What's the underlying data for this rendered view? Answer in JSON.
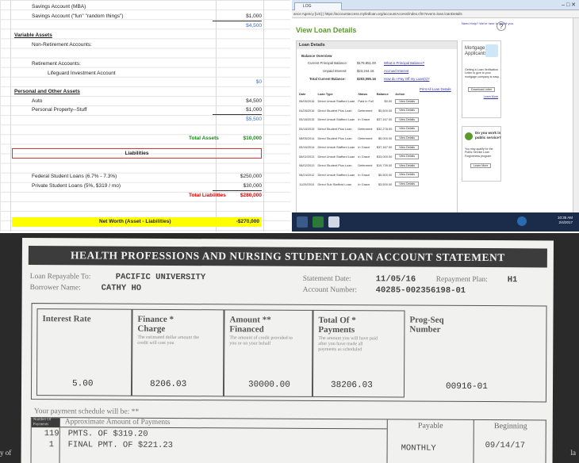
{
  "spreadsheet": {
    "rows": [
      {
        "label": "Savings Account (MBA)",
        "indent": 1,
        "value": "",
        "style": ""
      },
      {
        "label": "Savings Account (\"fun\" \"random things\")",
        "indent": 1,
        "value": "$1,000",
        "style": "ul"
      },
      {
        "label": "",
        "indent": 0,
        "value": "$4,500",
        "style": "blue"
      },
      {
        "label": "Variable Assets",
        "indent": 0,
        "value": "",
        "style": "sec"
      },
      {
        "label": "Non-Retirement Accounts:",
        "indent": 1,
        "value": "",
        "style": ""
      },
      {
        "label": "",
        "indent": 0,
        "value": "",
        "style": ""
      },
      {
        "label": "Retirement Accounts:",
        "indent": 1,
        "value": "",
        "style": ""
      },
      {
        "label": "Lifeguard Investment Account",
        "indent": 2,
        "value": "",
        "style": ""
      },
      {
        "label": "",
        "indent": 0,
        "value": "$0",
        "style": "blue"
      },
      {
        "label": "Personal and Other Assets",
        "indent": 0,
        "value": "",
        "style": "sec"
      },
      {
        "label": "Auto",
        "indent": 1,
        "value": "$4,500",
        "style": ""
      },
      {
        "label": "Personal Property--Stuff",
        "indent": 1,
        "value": "$1,000",
        "style": "ul"
      },
      {
        "label": "",
        "indent": 0,
        "value": "$5,500",
        "style": "blue"
      },
      {
        "label": "",
        "indent": 0,
        "value": "",
        "style": ""
      },
      {
        "label": "Total Assets",
        "indent": 3,
        "value": "$10,000",
        "style": "green"
      },
      {
        "label": "",
        "indent": 0,
        "value": "",
        "style": ""
      },
      {
        "label": "",
        "indent": 0,
        "value": "",
        "style": ""
      },
      {
        "label": "Federal Student Loans (6.7% - 7.3%)",
        "indent": 1,
        "value": "$250,000",
        "style": ""
      },
      {
        "label": "Private Student Loans (5%, $319 / mo)",
        "indent": 1,
        "value": "$30,000",
        "style": "ul"
      },
      {
        "label": "Total Liabilities",
        "indent": 3,
        "value": "$280,000",
        "style": "red"
      }
    ],
    "liabilities_label": "Liabilities",
    "net_worth_label": "Net Worth (Asset - Liabilities)",
    "net_worth_value": "-$270,000"
  },
  "browser": {
    "tab_label": "LOG",
    "address": "ance Agency [US] | https://accountaccess.myfedloan.org/accountAccess/index.cfm?event=loan.loanDetails",
    "page_title": "View Loan Details",
    "help_text": "Need Help? We're here to assist you.",
    "panel_title": "Loan Details",
    "balance_overview": "Balance Overview",
    "balances": [
      {
        "label": "Current Principal Balance:",
        "value": "$179,851.00",
        "link": "What is Principal Balance?"
      },
      {
        "label": "Unpaid Interest:",
        "value": "$23,244.16",
        "link": "Accrued Interest"
      },
      {
        "label": "Total Current Balance:",
        "value": "$203,095.16",
        "link": "How do I Pay Off my Loan(s)?"
      }
    ],
    "print_link": "Print All Loan Details",
    "table_headers": [
      "Date",
      "Loan Type",
      "Status",
      "Balance",
      "Action"
    ],
    "loans": [
      {
        "date": "06/05/2016",
        "type": "Direct Unsub Stafford Loan",
        "status": "Paid In Full",
        "balance": "$0.00"
      },
      {
        "date": "04/28/2016",
        "type": "Direct Student Plus Loan",
        "status": "Deferment",
        "balance": "$5,500.00"
      },
      {
        "date": "05/18/2015",
        "type": "Direct Unsub Stafford Loan",
        "status": "In Grace",
        "balance": "$37,167.00"
      },
      {
        "date": "05/18/2015",
        "type": "Direct Student Plus Loan",
        "status": "Deferment",
        "balance": "$32,278.00"
      },
      {
        "date": "08/05/2014",
        "type": "Direct Student Plus Loan",
        "status": "Deferment",
        "balance": "$5,000.00"
      },
      {
        "date": "05/16/2014",
        "type": "Direct Unsub Stafford Loan",
        "status": "In Grace",
        "balance": "$37,167.00"
      },
      {
        "date": "08/02/2013",
        "type": "Direct Unsub Stafford Loan",
        "status": "In Grace",
        "balance": "$33,000.00"
      },
      {
        "date": "08/02/2013",
        "type": "Direct Student Plus Loan",
        "status": "Deferment",
        "balance": "$19,739.00"
      },
      {
        "date": "08/24/2012",
        "type": "Direct Unsub Stafford Loan",
        "status": "In Grace",
        "balance": "$5,500.00"
      },
      {
        "date": "11/29/2010",
        "type": "Direct Sub Stafford Loan",
        "status": "In Grace",
        "balance": "$3,500.00"
      }
    ],
    "view_details": "View Details",
    "mortgage_title": "Mortgage Applicants",
    "mortgage_text": "Getting a Loan Verification Letter to give to your mortgage company is easy.",
    "download_btn": "Download Letter",
    "learn_more": "Learn More",
    "public_title": "Do you work in public service?",
    "public_text": "You may qualify for the Public Service Loan Forgiveness program.",
    "learn_btn": "Learn More",
    "clock_time": "10:35 AM",
    "clock_date": "2/4/2017"
  },
  "statement": {
    "header": "HEALTH PROFESSIONS AND NURSING STUDENT LOAN ACCOUNT STATEMENT",
    "repay_label": "Loan Repayable To:",
    "repay_value": "PACIFIC UNIVERSITY",
    "borrower_label": "Borrower Name:",
    "borrower_value": "CATHY HO",
    "stmt_date_label": "Statement Date:",
    "stmt_date_value": "11/05/16",
    "plan_label": "Repayment Plan:",
    "plan_value": "H1",
    "acct_label": "Account Number:",
    "acct_value": "40285-002356198-01",
    "cols": [
      {
        "h": "Interest Rate",
        "s": "",
        "v": "5.00"
      },
      {
        "h": "Finance * Charge",
        "s": "The estimated dollar amount the credit will cost you",
        "v": "8206.03"
      },
      {
        "h": "Amount ** Financed",
        "s": "The amount of credit provided to you or on your behalf",
        "v": "30000.00"
      },
      {
        "h": "Total Of * Payments",
        "s": "The amount you will have paid after you have made all payments as scheduled",
        "v": "38206.03"
      },
      {
        "h": "Prog-Seq Number",
        "s": "",
        "v": "00916-01"
      }
    ],
    "schedule_label": "Your payment schedule will be: **",
    "sched_h_num": "Number Of Payments",
    "sched_h_amt": "Approximate Amount of Payments",
    "sched_h_payable": "Payable",
    "sched_h_begin": "Beginning",
    "sched_row1_num": "119",
    "sched_row1_text": "PMTS. OF  $319.20",
    "sched_row2_num": "1",
    "sched_row2_text": "FINAL PMT. OF  $221.23",
    "payable_value": "MONTHLY",
    "begin_value": "09/14/17",
    "edge_left": "y of",
    "edge_right": "la"
  }
}
